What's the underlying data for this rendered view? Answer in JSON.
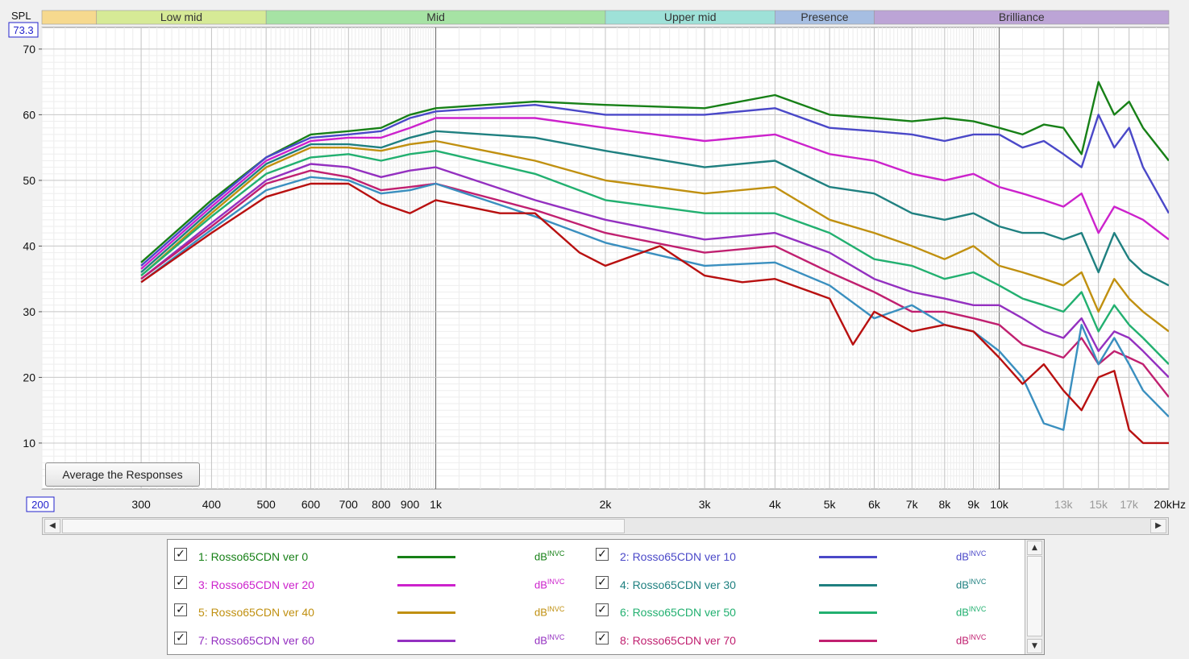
{
  "bands": [
    {
      "name": "",
      "from": 200,
      "to": 250,
      "color": "#f6d98e"
    },
    {
      "name": "Low mid",
      "from": 250,
      "to": 500,
      "color": "#d6ea96"
    },
    {
      "name": "Mid",
      "from": 500,
      "to": 2000,
      "color": "#a6e3a4"
    },
    {
      "name": "Upper mid",
      "from": 2000,
      "to": 4000,
      "color": "#9ee1d8"
    },
    {
      "name": "Presence",
      "from": 4000,
      "to": 6000,
      "color": "#a6bee2"
    },
    {
      "name": "Brilliance",
      "from": 6000,
      "to": 20000,
      "color": "#bca4d6"
    }
  ],
  "y_axis_label": "SPL",
  "y_top_value": "73.3",
  "x_left_value": "200",
  "average_button": "Average the Responses",
  "legend_unit": "dB",
  "legend_unit_sup": "INVC",
  "chart_data": {
    "type": "line",
    "xscale": "log",
    "xlim": [
      200,
      20000
    ],
    "ylim": [
      3,
      73.3
    ],
    "x_ticks": [
      {
        "v": 300,
        "l": "300"
      },
      {
        "v": 400,
        "l": "400"
      },
      {
        "v": 500,
        "l": "500"
      },
      {
        "v": 600,
        "l": "600"
      },
      {
        "v": 700,
        "l": "700"
      },
      {
        "v": 800,
        "l": "800"
      },
      {
        "v": 900,
        "l": "900"
      },
      {
        "v": 1000,
        "l": "1k"
      },
      {
        "v": 2000,
        "l": "2k"
      },
      {
        "v": 3000,
        "l": "3k"
      },
      {
        "v": 4000,
        "l": "4k"
      },
      {
        "v": 5000,
        "l": "5k"
      },
      {
        "v": 6000,
        "l": "6k"
      },
      {
        "v": 7000,
        "l": "7k"
      },
      {
        "v": 8000,
        "l": "8k"
      },
      {
        "v": 9000,
        "l": "9k"
      },
      {
        "v": 10000,
        "l": "10k"
      },
      {
        "v": 13000,
        "l": "13k",
        "faded": true
      },
      {
        "v": 15000,
        "l": "15k",
        "faded": true
      },
      {
        "v": 17000,
        "l": "17k",
        "faded": true
      },
      {
        "v": 20000,
        "l": "20kHz"
      }
    ],
    "y_ticks": [
      10,
      20,
      30,
      40,
      50,
      60,
      70
    ],
    "grid": true,
    "series": [
      {
        "name": "1: Rosso65CDN ver 0",
        "color": "#178017",
        "x": [
          300,
          400,
          500,
          600,
          700,
          800,
          900,
          1000,
          1500,
          2000,
          3000,
          4000,
          5000,
          6000,
          7000,
          8000,
          9000,
          10000,
          11000,
          12000,
          13000,
          14000,
          15000,
          16000,
          17000,
          18000,
          20000
        ],
        "y": [
          37.5,
          47,
          53.5,
          57,
          57.5,
          58,
          60,
          61,
          62,
          61.5,
          61,
          63,
          60,
          59.5,
          59,
          59.5,
          59,
          58,
          57,
          58.5,
          58,
          54,
          65,
          60,
          62,
          58,
          53
        ]
      },
      {
        "name": "2: Rosso65CDN ver 10",
        "color": "#4a48c8",
        "x": [
          300,
          400,
          500,
          600,
          700,
          800,
          900,
          1000,
          1500,
          2000,
          3000,
          4000,
          5000,
          6000,
          7000,
          8000,
          9000,
          10000,
          11000,
          12000,
          13000,
          14000,
          15000,
          16000,
          17000,
          18000,
          20000
        ],
        "y": [
          37,
          46.5,
          53.5,
          56.5,
          57,
          57.5,
          59.5,
          60.5,
          61.5,
          60,
          60,
          61,
          58,
          57.5,
          57,
          56,
          57,
          57,
          55,
          56,
          54,
          52,
          60,
          55,
          58,
          52,
          45
        ]
      },
      {
        "name": "3: Rosso65CDN ver 20",
        "color": "#cc22cc",
        "x": [
          300,
          400,
          500,
          600,
          700,
          800,
          900,
          1000,
          1500,
          2000,
          3000,
          4000,
          5000,
          6000,
          7000,
          8000,
          9000,
          10000,
          11000,
          12000,
          13000,
          14000,
          15000,
          16000,
          17000,
          18000,
          20000
        ],
        "y": [
          36.5,
          46,
          53,
          56,
          56.5,
          56.5,
          58,
          59.5,
          59.5,
          58,
          56,
          57,
          54,
          53,
          51,
          50,
          51,
          49,
          48,
          47,
          46,
          48,
          42,
          46,
          45,
          44,
          41
        ]
      },
      {
        "name": "4: Rosso65CDN ver 30",
        "color": "#1f8080",
        "x": [
          300,
          400,
          500,
          600,
          700,
          800,
          900,
          1000,
          1500,
          2000,
          3000,
          4000,
          5000,
          6000,
          7000,
          8000,
          9000,
          10000,
          11000,
          12000,
          13000,
          14000,
          15000,
          16000,
          17000,
          18000,
          20000
        ],
        "y": [
          36,
          45.5,
          52.5,
          55.5,
          55.5,
          55,
          56.5,
          57.5,
          56.5,
          54.5,
          52,
          53,
          49,
          48,
          45,
          44,
          45,
          43,
          42,
          42,
          41,
          42,
          36,
          42,
          38,
          36,
          34
        ]
      },
      {
        "name": "5: Rosso65CDN ver 40",
        "color": "#c09010",
        "x": [
          300,
          400,
          500,
          600,
          700,
          800,
          900,
          1000,
          1500,
          2000,
          3000,
          4000,
          5000,
          6000,
          7000,
          8000,
          9000,
          10000,
          11000,
          12000,
          13000,
          14000,
          15000,
          16000,
          17000,
          18000,
          20000
        ],
        "y": [
          35.5,
          45,
          52,
          55,
          55,
          54.5,
          55.5,
          56,
          53,
          50,
          48,
          49,
          44,
          42,
          40,
          38,
          40,
          37,
          36,
          35,
          34,
          36,
          30,
          35,
          32,
          30,
          27
        ]
      },
      {
        "name": "6: Rosso65CDN ver 50",
        "color": "#22b070",
        "x": [
          300,
          400,
          500,
          600,
          700,
          800,
          900,
          1000,
          1500,
          2000,
          3000,
          4000,
          5000,
          6000,
          7000,
          8000,
          9000,
          10000,
          11000,
          12000,
          13000,
          14000,
          15000,
          16000,
          17000,
          18000,
          20000
        ],
        "y": [
          35.5,
          44.5,
          51,
          53.5,
          54,
          53,
          54,
          54.5,
          51,
          47,
          45,
          45,
          42,
          38,
          37,
          35,
          36,
          34,
          32,
          31,
          30,
          33,
          27,
          31,
          28,
          26,
          22
        ]
      },
      {
        "name": "7: Rosso65CDN ver 60",
        "color": "#9430c0",
        "x": [
          300,
          400,
          500,
          600,
          700,
          800,
          900,
          1000,
          1500,
          2000,
          3000,
          4000,
          5000,
          6000,
          7000,
          8000,
          9000,
          10000,
          11000,
          12000,
          13000,
          14000,
          15000,
          16000,
          17000,
          18000,
          20000
        ],
        "y": [
          35,
          43.5,
          50,
          52.5,
          52,
          50.5,
          51.5,
          52,
          47,
          44,
          41,
          42,
          39,
          35,
          33,
          32,
          31,
          31,
          29,
          27,
          26,
          29,
          24,
          27,
          26,
          24,
          20
        ]
      },
      {
        "name": "8: Rosso65CDN ver 70",
        "color": "#c02070",
        "x": [
          300,
          400,
          500,
          600,
          700,
          800,
          900,
          1000,
          1500,
          2000,
          3000,
          4000,
          5000,
          6000,
          7000,
          8000,
          9000,
          10000,
          11000,
          12000,
          13000,
          14000,
          15000,
          16000,
          17000,
          18000,
          20000
        ],
        "y": [
          35,
          43,
          49.5,
          51.5,
          50.5,
          48.5,
          49,
          49.5,
          45.5,
          42,
          39,
          40,
          36,
          33,
          30,
          30,
          29,
          28,
          25,
          24,
          23,
          26,
          22,
          24,
          23,
          22,
          17
        ]
      },
      {
        "name": "",
        "color": "#3a8fbf",
        "hide_legend": true,
        "x": [
          300,
          400,
          500,
          600,
          700,
          800,
          900,
          1000,
          1500,
          2000,
          3000,
          4000,
          5000,
          6000,
          7000,
          8000,
          9000,
          10000,
          11000,
          12000,
          13000,
          14000,
          15000,
          16000,
          17000,
          18000,
          20000
        ],
        "y": [
          34.5,
          42.5,
          48.5,
          50.5,
          50,
          48,
          48.5,
          49.5,
          44.5,
          40.5,
          37,
          37.5,
          34,
          29,
          31,
          28,
          27,
          24,
          20,
          13,
          12,
          28,
          22,
          26,
          22,
          18,
          14
        ]
      },
      {
        "name": "",
        "color": "#b81010",
        "hide_legend": true,
        "x": [
          300,
          400,
          500,
          600,
          700,
          800,
          900,
          1000,
          1300,
          1500,
          1800,
          2000,
          2500,
          3000,
          3500,
          4000,
          5000,
          5500,
          6000,
          7000,
          8000,
          9000,
          10000,
          11000,
          12000,
          13000,
          14000,
          15000,
          16000,
          17000,
          18000,
          20000
        ],
        "y": [
          34.5,
          42,
          47.5,
          49.5,
          49.5,
          46.5,
          45,
          47,
          45,
          45,
          39,
          37,
          40,
          35.5,
          34.5,
          35,
          32,
          25,
          30,
          27,
          28,
          27,
          23,
          19,
          22,
          18,
          15,
          20,
          21,
          12,
          10,
          10
        ]
      }
    ]
  }
}
